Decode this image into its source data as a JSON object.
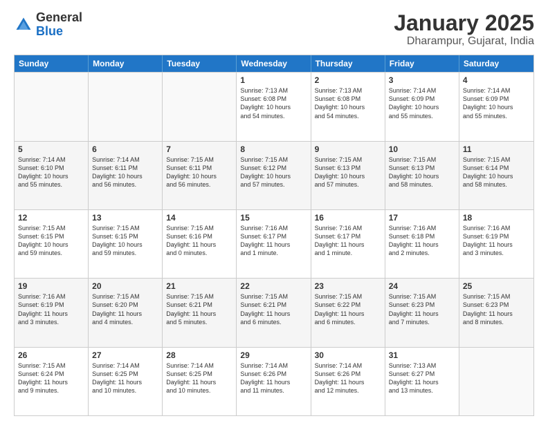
{
  "logo": {
    "general": "General",
    "blue": "Blue"
  },
  "title": "January 2025",
  "subtitle": "Dharampur, Gujarat, India",
  "days": [
    "Sunday",
    "Monday",
    "Tuesday",
    "Wednesday",
    "Thursday",
    "Friday",
    "Saturday"
  ],
  "weeks": [
    [
      {
        "day": "",
        "info": ""
      },
      {
        "day": "",
        "info": ""
      },
      {
        "day": "",
        "info": ""
      },
      {
        "day": "1",
        "info": "Sunrise: 7:13 AM\nSunset: 6:08 PM\nDaylight: 10 hours\nand 54 minutes."
      },
      {
        "day": "2",
        "info": "Sunrise: 7:13 AM\nSunset: 6:08 PM\nDaylight: 10 hours\nand 54 minutes."
      },
      {
        "day": "3",
        "info": "Sunrise: 7:14 AM\nSunset: 6:09 PM\nDaylight: 10 hours\nand 55 minutes."
      },
      {
        "day": "4",
        "info": "Sunrise: 7:14 AM\nSunset: 6:09 PM\nDaylight: 10 hours\nand 55 minutes."
      }
    ],
    [
      {
        "day": "5",
        "info": "Sunrise: 7:14 AM\nSunset: 6:10 PM\nDaylight: 10 hours\nand 55 minutes."
      },
      {
        "day": "6",
        "info": "Sunrise: 7:14 AM\nSunset: 6:11 PM\nDaylight: 10 hours\nand 56 minutes."
      },
      {
        "day": "7",
        "info": "Sunrise: 7:15 AM\nSunset: 6:11 PM\nDaylight: 10 hours\nand 56 minutes."
      },
      {
        "day": "8",
        "info": "Sunrise: 7:15 AM\nSunset: 6:12 PM\nDaylight: 10 hours\nand 57 minutes."
      },
      {
        "day": "9",
        "info": "Sunrise: 7:15 AM\nSunset: 6:13 PM\nDaylight: 10 hours\nand 57 minutes."
      },
      {
        "day": "10",
        "info": "Sunrise: 7:15 AM\nSunset: 6:13 PM\nDaylight: 10 hours\nand 58 minutes."
      },
      {
        "day": "11",
        "info": "Sunrise: 7:15 AM\nSunset: 6:14 PM\nDaylight: 10 hours\nand 58 minutes."
      }
    ],
    [
      {
        "day": "12",
        "info": "Sunrise: 7:15 AM\nSunset: 6:15 PM\nDaylight: 10 hours\nand 59 minutes."
      },
      {
        "day": "13",
        "info": "Sunrise: 7:15 AM\nSunset: 6:15 PM\nDaylight: 10 hours\nand 59 minutes."
      },
      {
        "day": "14",
        "info": "Sunrise: 7:15 AM\nSunset: 6:16 PM\nDaylight: 11 hours\nand 0 minutes."
      },
      {
        "day": "15",
        "info": "Sunrise: 7:16 AM\nSunset: 6:17 PM\nDaylight: 11 hours\nand 1 minute."
      },
      {
        "day": "16",
        "info": "Sunrise: 7:16 AM\nSunset: 6:17 PM\nDaylight: 11 hours\nand 1 minute."
      },
      {
        "day": "17",
        "info": "Sunrise: 7:16 AM\nSunset: 6:18 PM\nDaylight: 11 hours\nand 2 minutes."
      },
      {
        "day": "18",
        "info": "Sunrise: 7:16 AM\nSunset: 6:19 PM\nDaylight: 11 hours\nand 3 minutes."
      }
    ],
    [
      {
        "day": "19",
        "info": "Sunrise: 7:16 AM\nSunset: 6:19 PM\nDaylight: 11 hours\nand 3 minutes."
      },
      {
        "day": "20",
        "info": "Sunrise: 7:15 AM\nSunset: 6:20 PM\nDaylight: 11 hours\nand 4 minutes."
      },
      {
        "day": "21",
        "info": "Sunrise: 7:15 AM\nSunset: 6:21 PM\nDaylight: 11 hours\nand 5 minutes."
      },
      {
        "day": "22",
        "info": "Sunrise: 7:15 AM\nSunset: 6:21 PM\nDaylight: 11 hours\nand 6 minutes."
      },
      {
        "day": "23",
        "info": "Sunrise: 7:15 AM\nSunset: 6:22 PM\nDaylight: 11 hours\nand 6 minutes."
      },
      {
        "day": "24",
        "info": "Sunrise: 7:15 AM\nSunset: 6:23 PM\nDaylight: 11 hours\nand 7 minutes."
      },
      {
        "day": "25",
        "info": "Sunrise: 7:15 AM\nSunset: 6:23 PM\nDaylight: 11 hours\nand 8 minutes."
      }
    ],
    [
      {
        "day": "26",
        "info": "Sunrise: 7:15 AM\nSunset: 6:24 PM\nDaylight: 11 hours\nand 9 minutes."
      },
      {
        "day": "27",
        "info": "Sunrise: 7:14 AM\nSunset: 6:25 PM\nDaylight: 11 hours\nand 10 minutes."
      },
      {
        "day": "28",
        "info": "Sunrise: 7:14 AM\nSunset: 6:25 PM\nDaylight: 11 hours\nand 10 minutes."
      },
      {
        "day": "29",
        "info": "Sunrise: 7:14 AM\nSunset: 6:26 PM\nDaylight: 11 hours\nand 11 minutes."
      },
      {
        "day": "30",
        "info": "Sunrise: 7:14 AM\nSunset: 6:26 PM\nDaylight: 11 hours\nand 12 minutes."
      },
      {
        "day": "31",
        "info": "Sunrise: 7:13 AM\nSunset: 6:27 PM\nDaylight: 11 hours\nand 13 minutes."
      },
      {
        "day": "",
        "info": ""
      }
    ]
  ]
}
